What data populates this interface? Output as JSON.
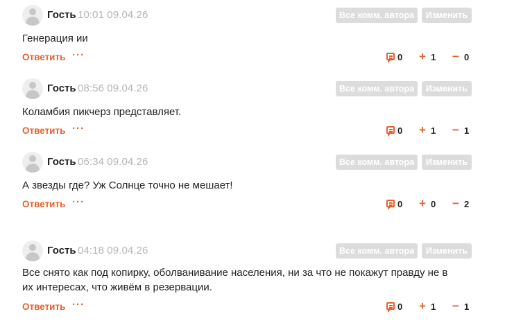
{
  "buttons": {
    "author_comments": "Все комм. автора",
    "edit": "Изменить"
  },
  "actions": {
    "reply": "Ответить",
    "more": "···"
  },
  "comments": [
    {
      "author": "Гость",
      "time": "10:01 09.04.26",
      "text": "Генерация ии",
      "comments": "0",
      "plus": "1",
      "minus": "0"
    },
    {
      "author": "Гость",
      "time": "08:56 09.04.26",
      "text": "Коламбия пикчерз представляет.",
      "comments": "0",
      "plus": "1",
      "minus": "1"
    },
    {
      "author": "Гость",
      "time": "06:34 09.04.26",
      "text": "А звезды где? Уж Солнце точно не мешает!",
      "comments": "0",
      "plus": "0",
      "minus": "2"
    },
    {
      "author": "Гость",
      "time": "04:18 09.04.26",
      "text": "Все снято как под копирку, оболванивание населения, ни за что не покажут правду не в их интересах, что живём в резервации.",
      "comments": "0",
      "plus": "1",
      "minus": "1"
    }
  ]
}
